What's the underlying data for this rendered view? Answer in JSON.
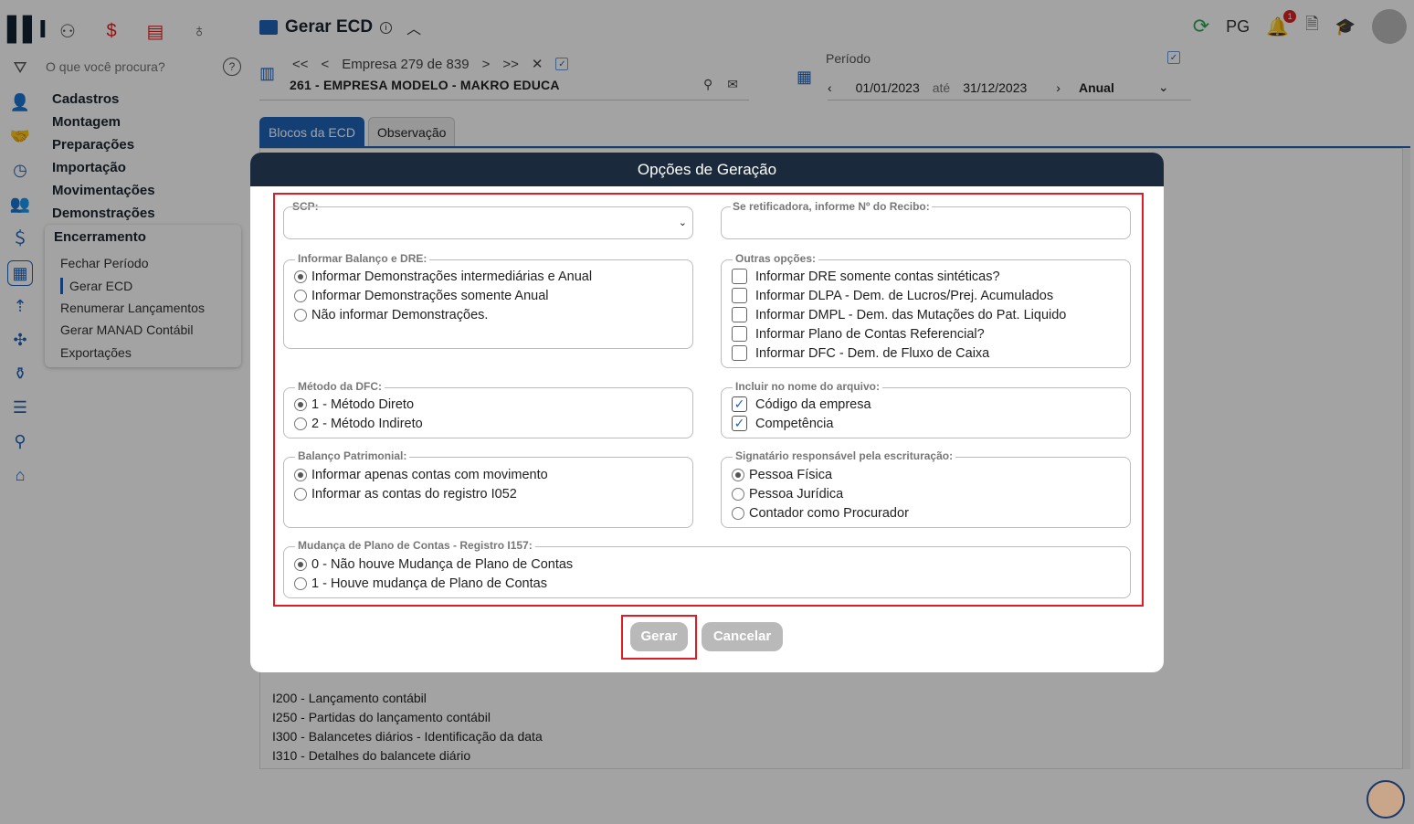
{
  "app": {
    "search_placeholder": "O que você procura?",
    "menu": [
      "Cadastros",
      "Montagem",
      "Preparações",
      "Importação",
      "Movimentações",
      "Demonstrações"
    ],
    "submenu": {
      "header": "Encerramento",
      "items": [
        "Fechar Período",
        "Gerar ECD",
        "Renumerar Lançamentos",
        "Gerar MANAD Contábil",
        "Exportações"
      ],
      "active": "Gerar ECD"
    }
  },
  "header": {
    "title": "Gerar ECD",
    "user_initials": "PG",
    "notifications": "1"
  },
  "empresa": {
    "nav_first": "<<",
    "nav_prev": "<",
    "nav_text": "Empresa 279 de 839",
    "nav_next": ">",
    "nav_last": ">>",
    "close": "✕",
    "name": "261 - EMPRESA MODELO - MAKRO EDUCA"
  },
  "periodo": {
    "label": "Período",
    "from": "01/01/2023",
    "sep": "até",
    "to": "31/12/2023",
    "type": "Anual"
  },
  "tabs": [
    "Blocos da ECD",
    "Observação"
  ],
  "blocks": [
    "I200 - Lançamento contábil",
    "I250 - Partidas do lançamento contábil",
    "I300 - Balancetes diários - Identificação da data",
    "I310 - Detalhes do balancete diário"
  ],
  "modal": {
    "title": "Opções de Geração",
    "scp_label": "SCP:",
    "scp_value": "",
    "recibo_label": "Se retificadora, informe Nº do Recibo:",
    "recibo_value": "",
    "balanco_dre": {
      "legend": "Informar Balanço e DRE:",
      "options": [
        "Informar Demonstrações intermediárias e Anual",
        "Informar Demonstrações somente Anual",
        "Não informar Demonstrações."
      ],
      "selected": 0
    },
    "outras": {
      "legend": "Outras opções:",
      "options": [
        "Informar DRE somente contas sintéticas?",
        "Informar DLPA - Dem. de Lucros/Prej. Acumulados",
        "Informar DMPL - Dem. das Mutações do Pat. Liquido",
        "Informar Plano de Contas Referencial?",
        "Informar DFC - Dem. de Fluxo de Caixa"
      ],
      "checked": [
        false,
        false,
        false,
        false,
        false
      ]
    },
    "metodo_dfc": {
      "legend": "Método da DFC:",
      "options": [
        "1 - Método Direto",
        "2 - Método Indireto"
      ],
      "selected": 0
    },
    "nome_arquivo": {
      "legend": "Incluir no nome do arquivo:",
      "options": [
        "Código da empresa",
        "Competência"
      ],
      "checked": [
        true,
        true
      ]
    },
    "balanco_patrimonial": {
      "legend": "Balanço Patrimonial:",
      "options": [
        "Informar apenas contas com movimento",
        "Informar as contas do registro I052"
      ],
      "selected": 0
    },
    "signatario": {
      "legend": "Signatário responsável pela escrituração:",
      "options": [
        "Pessoa Física",
        "Pessoa Jurídica",
        "Contador como Procurador"
      ],
      "selected": 0
    },
    "mudanca_plano": {
      "legend": "Mudança de Plano de Contas - Registro I157:",
      "options": [
        "0 - Não houve Mudança de Plano de Contas",
        "1 - Houve mudança de Plano de Contas"
      ],
      "selected": 0
    },
    "btn_gerar": "Gerar",
    "btn_cancelar": "Cancelar"
  },
  "colors": {
    "accent": "#1f63b8",
    "modal_header": "#1a2a3c",
    "highlight": "#e01b24",
    "button_disabled": "#b9b9b9"
  }
}
